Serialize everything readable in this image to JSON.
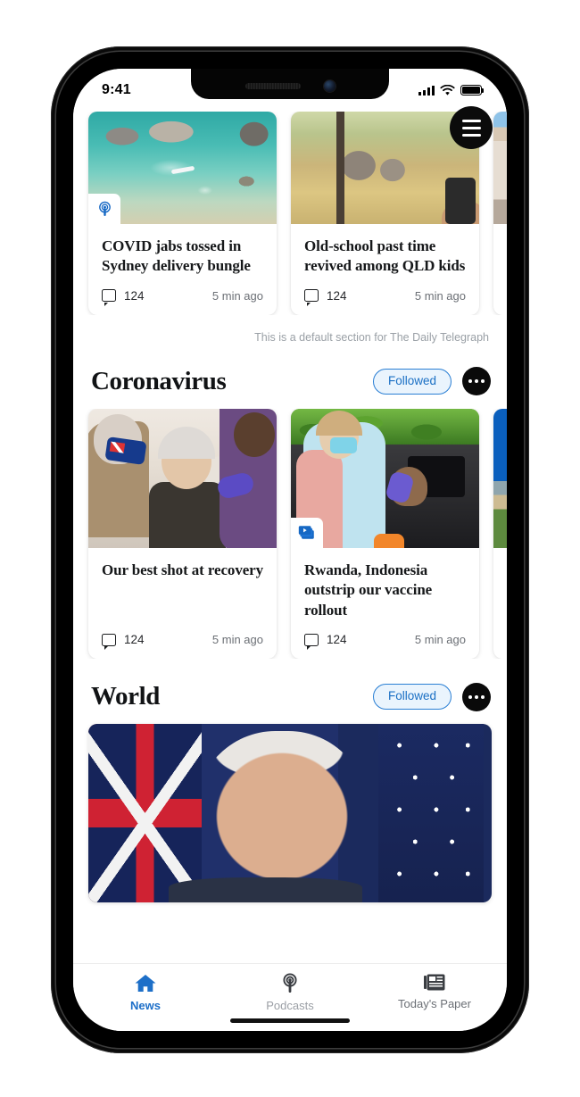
{
  "status_bar": {
    "time": "9:41",
    "signal_icon": "cellular-bars-icon",
    "wifi_icon": "wifi-icon",
    "battery_icon": "battery-full-icon"
  },
  "menu_button": {
    "icon": "hamburger-menu-icon",
    "label": "Menu"
  },
  "colors": {
    "accent_blue": "#1d6fc8",
    "pill_border": "#2a7fd4",
    "pill_fill": "#eaf4fd",
    "pill_text": "#1a6fc4",
    "muted_text": "#6b6f75",
    "dark_text": "#16181a"
  },
  "sections": [
    {
      "id": "default-section",
      "title": "",
      "show_header": false,
      "note": "This is a default section for The Daily Telegraph",
      "cards": [
        {
          "title": "COVID jabs tossed in Sydney delivery bungle",
          "comments": "124",
          "time": "5 min ago",
          "badge": "podcast-badge-icon",
          "image": "aerial-lagoon-paddleboarders"
        },
        {
          "title": "Old-school past time revived among QLD kids",
          "comments": "124",
          "time": "5 min ago",
          "badge": "",
          "image": "elephants-safari-phone"
        },
        {
          "title": "",
          "comments": "",
          "time": "",
          "badge": "",
          "image": "historic-building"
        }
      ]
    },
    {
      "id": "coronavirus-section",
      "title": "Coronavirus",
      "show_header": true,
      "follow_label": "Followed",
      "more_label": "More options",
      "note": "",
      "cards": [
        {
          "title": "Our best shot at recovery",
          "comments": "124",
          "time": "5 min ago",
          "badge": "",
          "image": "vaccination-elderly-woman"
        },
        {
          "title": "Rwanda, Indonesia outstrip our vaccine rollout",
          "comments": "124",
          "time": "5 min ago",
          "badge": "video-gallery-badge-icon",
          "image": "drive-through-testing"
        },
        {
          "title": "",
          "comments": "",
          "time": "",
          "badge": "",
          "image": "blue-sky-field"
        }
      ]
    },
    {
      "id": "world-section",
      "title": "World",
      "show_header": true,
      "follow_label": "Followed",
      "more_label": "More options",
      "note": "",
      "hero_image": "joe-biden-portrait-flags",
      "cards": []
    }
  ],
  "tab_bar": {
    "tabs": [
      {
        "label": "News",
        "icon": "home-icon",
        "active": true
      },
      {
        "label": "Podcasts",
        "icon": "podcast-icon",
        "active": false
      },
      {
        "label": "Today's Paper",
        "icon": "newspaper-icon",
        "active": false
      }
    ]
  }
}
